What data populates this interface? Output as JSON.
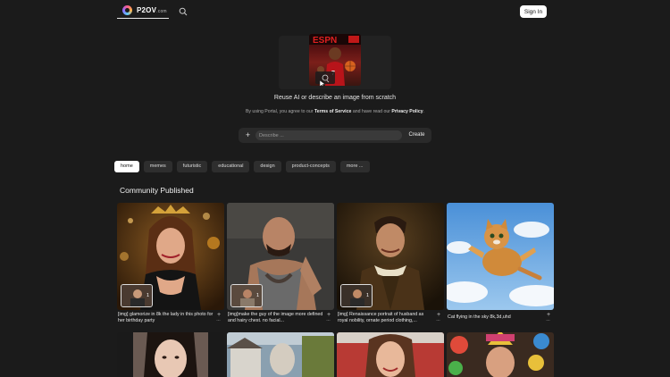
{
  "header": {
    "logo_text": "P2OV",
    "logo_suffix": ".com",
    "signin_label": "Sign In"
  },
  "hero": {
    "caption": "Reuse AI or describe an image from scratch",
    "terms_prefix": "By using Portal, you agree to our",
    "terms_link": "Terms of Service",
    "terms_middle": "and have read our",
    "privacy_link": "Privacy Policy",
    "terms_suffix": "."
  },
  "prompt": {
    "plus": "+",
    "placeholder": "Describe ...",
    "create_label": "Create"
  },
  "tags": [
    "home",
    "memes",
    "futuristic",
    "educational",
    "design",
    "product-concepts",
    "more ..."
  ],
  "section_title": "Community Published",
  "cards": [
    {
      "caption": "[img] glamorize in 8k the lady in this photo for her birthday party",
      "count": "1"
    },
    {
      "caption": "[img]make the guy of the image more defined and hairy chest. no facial...",
      "count": "1"
    },
    {
      "caption": "[img] Renaissance portrait of husband as royal nobility, ornate period clothing,...",
      "count": "1"
    },
    {
      "caption": "Cat flying in the sky 8k,3d,uhd",
      "count": ""
    }
  ],
  "card_plus": "+",
  "card_more": "···",
  "colors": {
    "background": "#1b1b1b",
    "tag_bg": "#2e2e2e",
    "tag_active_bg": "#ffffff"
  }
}
